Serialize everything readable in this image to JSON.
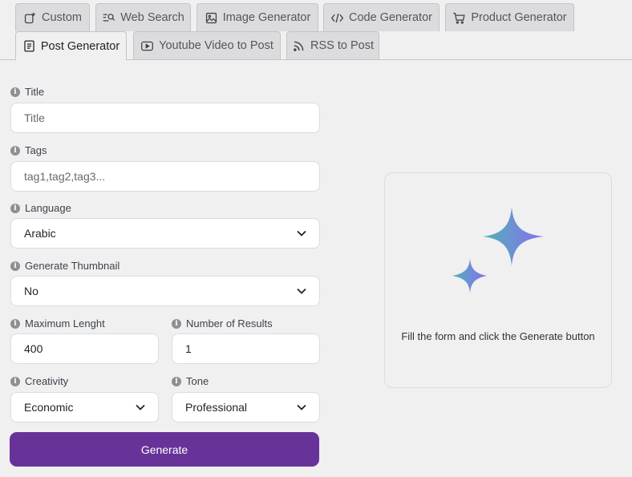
{
  "tabs": [
    {
      "label": "Custom",
      "icon": "sparkle-square-icon"
    },
    {
      "label": "Web Search",
      "icon": "search-list-icon"
    },
    {
      "label": "Image Generator",
      "icon": "image-icon"
    },
    {
      "label": "Code Generator",
      "icon": "code-icon"
    },
    {
      "label": "Product Generator",
      "icon": "cart-icon"
    },
    {
      "label": "Post Generator",
      "icon": "document-icon",
      "active": true
    },
    {
      "label": "Youtube Video to Post",
      "icon": "video-play-icon"
    },
    {
      "label": "RSS to Post",
      "icon": "rss-icon"
    }
  ],
  "form": {
    "title": {
      "label": "Title",
      "placeholder": "Title",
      "value": ""
    },
    "tags": {
      "label": "Tags",
      "placeholder": "tag1,tag2,tag3...",
      "value": ""
    },
    "language": {
      "label": "Language",
      "value": "Arabic"
    },
    "thumbnail": {
      "label": "Generate Thumbnail",
      "value": "No"
    },
    "max_length": {
      "label": "Maximum Lenght",
      "value": "400"
    },
    "num_results": {
      "label": "Number of Results",
      "value": "1"
    },
    "creativity": {
      "label": "Creativity",
      "value": "Economic"
    },
    "tone": {
      "label": "Tone",
      "value": "Professional"
    },
    "generate_label": "Generate"
  },
  "output": {
    "message": "Fill the form and click the Generate button"
  },
  "colors": {
    "accent": "#673399",
    "sparkle_start": "#4fb3b8",
    "sparkle_end": "#8b6cf0"
  }
}
